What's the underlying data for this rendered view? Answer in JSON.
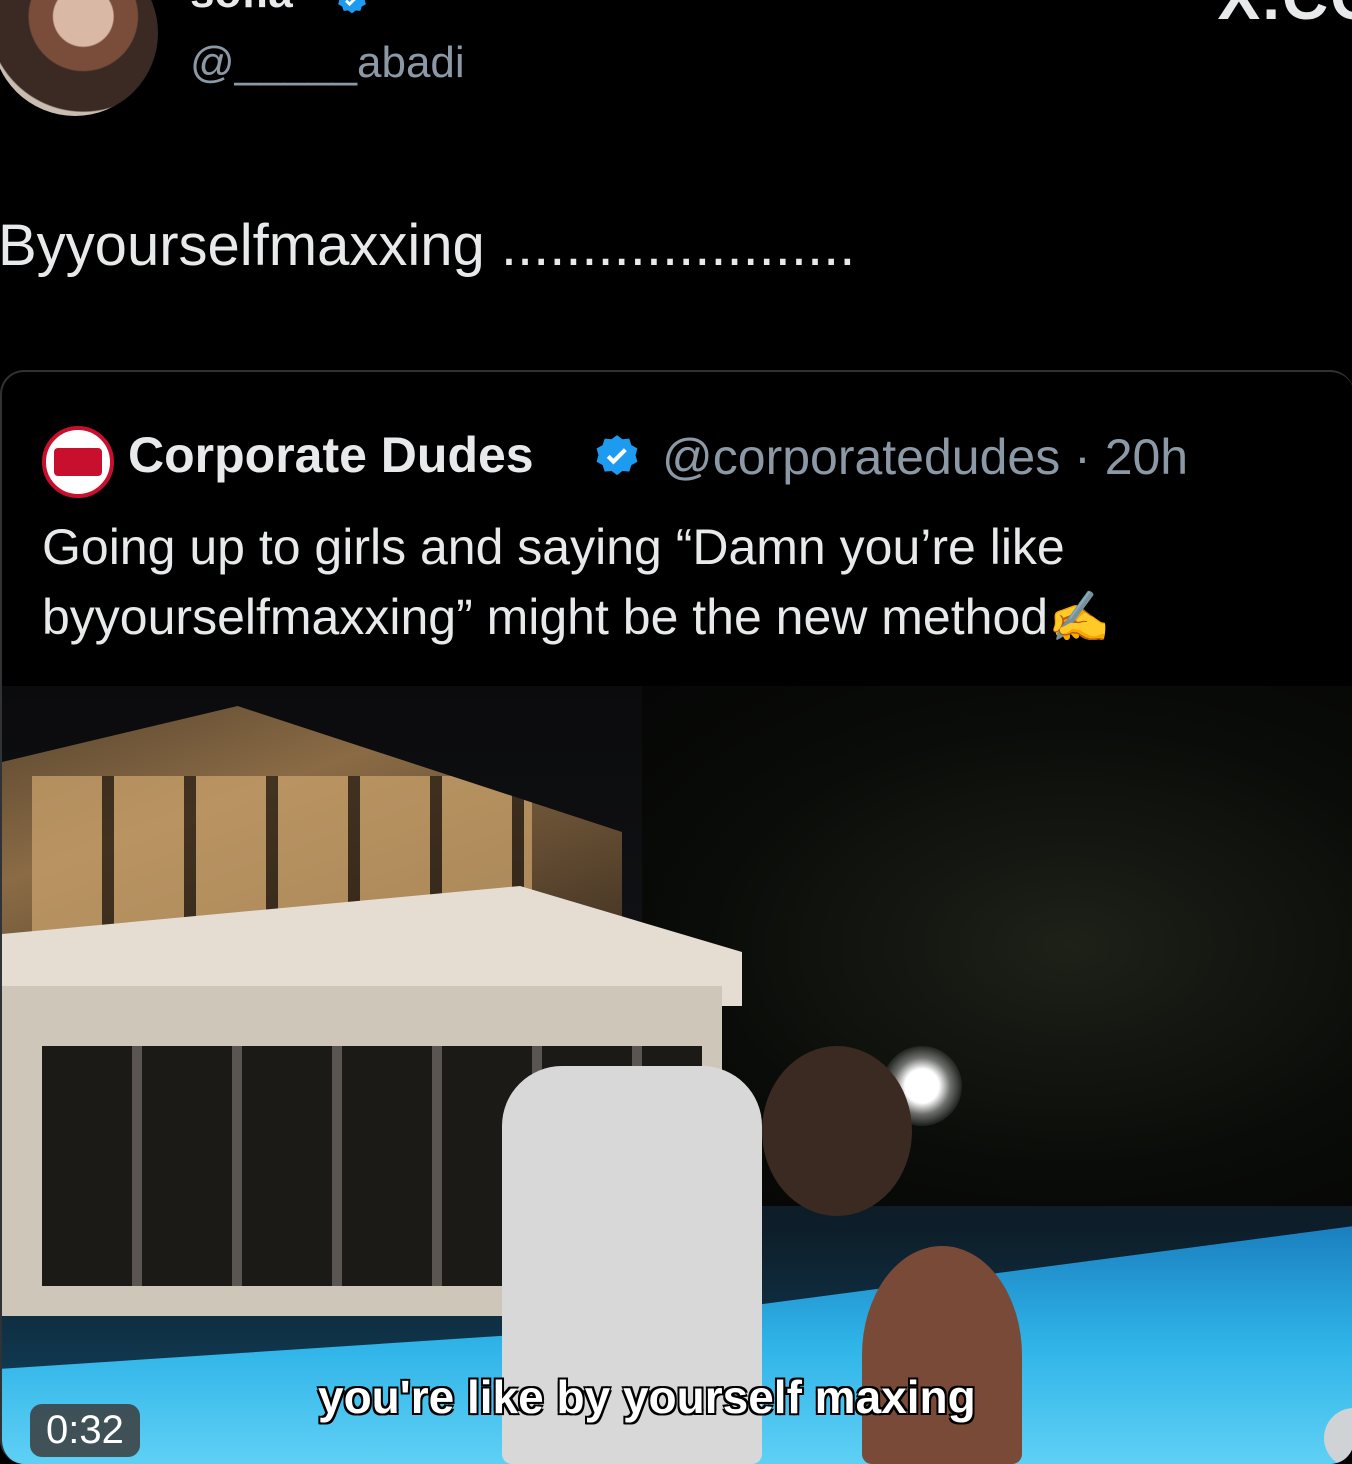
{
  "author": {
    "display_name": "sofia",
    "handle": "@_____abadi"
  },
  "brand_partial": "X.CO",
  "tweet": {
    "text": "Byyourselfmaxxing ......................"
  },
  "quoted": {
    "name": "Corporate Dudes",
    "handle": "@corporatedudes",
    "separator": "·",
    "time": "20h",
    "text": "Going up to girls and saying “Damn you’re like byyourselfmaxxing” might be the new method",
    "emoji": "✍️",
    "avatar_label": "Corporate Dudes"
  },
  "media": {
    "subtitle": "you're like by yourself maxing",
    "duration": "0:32"
  },
  "colors": {
    "background": "#000000",
    "text": "#e7e9ea",
    "secondary": "#8b98a5",
    "verified": "#1d9bf0",
    "border": "#2f3336"
  },
  "icons": {
    "verified": "verified-badge-icon",
    "writing": "writing-hand-icon"
  }
}
